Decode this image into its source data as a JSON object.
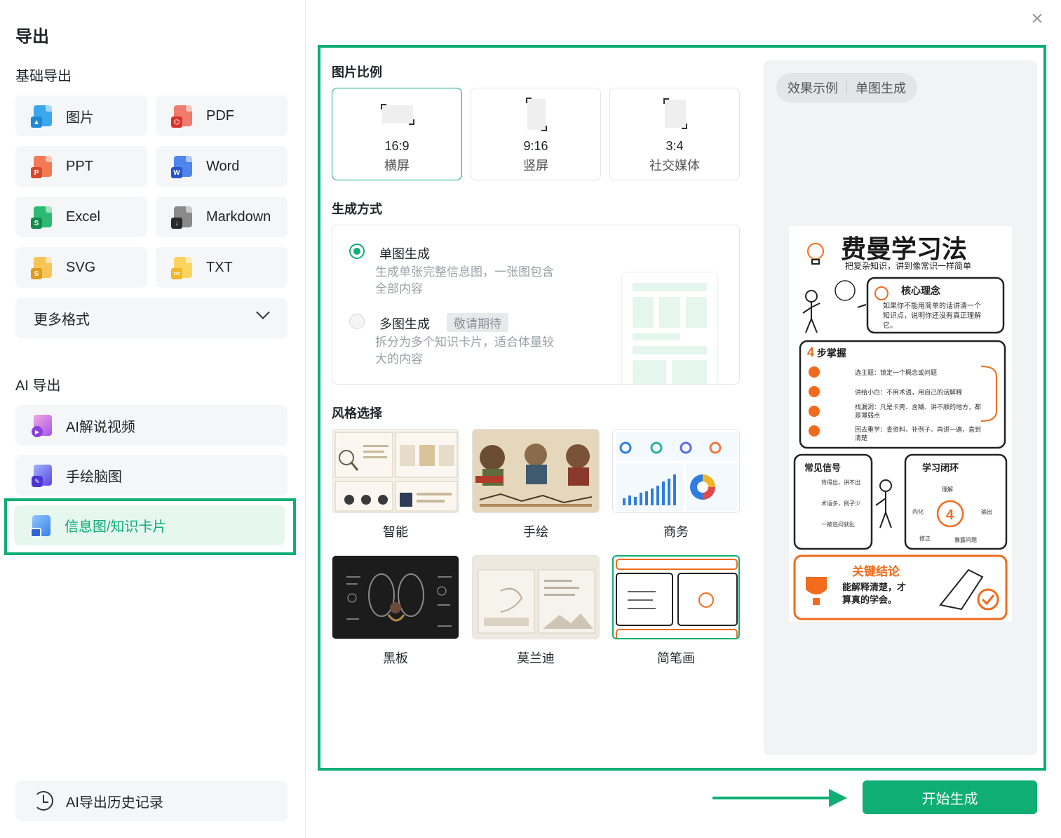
{
  "sidebar": {
    "title": "导出",
    "basic_label": "基础导出",
    "formats": [
      {
        "label": "图片",
        "icon": "image-file-icon",
        "color": "#3ba7ef"
      },
      {
        "label": "PDF",
        "icon": "pdf-file-icon",
        "color": "#e8453c"
      },
      {
        "label": "PPT",
        "icon": "ppt-file-icon",
        "color": "#e8553c"
      },
      {
        "label": "Word",
        "icon": "word-file-icon",
        "color": "#2f6de0"
      },
      {
        "label": "Excel",
        "icon": "excel-file-icon",
        "color": "#1aa15f"
      },
      {
        "label": "Markdown",
        "icon": "markdown-file-icon",
        "color": "#3a3a3a"
      },
      {
        "label": "SVG",
        "icon": "svg-file-icon",
        "color": "#f2b632"
      },
      {
        "label": "TXT",
        "icon": "txt-file-icon",
        "color": "#f4c343"
      }
    ],
    "more_formats": "更多格式",
    "ai_label": "AI 导出",
    "ai_items": [
      {
        "label": "AI解说视频",
        "icon": "ai-video-icon"
      },
      {
        "label": "手绘脑图",
        "icon": "mindmap-icon"
      },
      {
        "label": "信息图/知识卡片",
        "icon": "infographic-icon"
      }
    ],
    "history": "AI导出历史记录"
  },
  "main": {
    "ratio_label": "图片比例",
    "ratios": [
      {
        "value": "16:9",
        "name": "横屏"
      },
      {
        "value": "9:16",
        "name": "竖屏"
      },
      {
        "value": "3:4",
        "name": "社交媒体"
      }
    ],
    "mode_label": "生成方式",
    "single": {
      "title": "单图生成",
      "desc": "生成单张完整信息图，一张图包含全部内容"
    },
    "multi": {
      "title": "多图生成",
      "tag": "敬请期待",
      "desc": "拆分为多个知识卡片，适合体量较大的内容"
    },
    "style_label": "风格选择",
    "styles": [
      "智能",
      "手绘",
      "商务",
      "黑板",
      "莫兰迪",
      "简笔画"
    ],
    "preview": {
      "tab1": "效果示例",
      "tab2": "单图生成",
      "poster_title": "费曼学习法",
      "poster_subtitle": "把复杂知识，讲到像常识一样简单",
      "core_title": "核心理念",
      "core_text": "如果你不能用简单的话讲清一个知识点，说明你还没有真正理解它。",
      "steps_title": "步掌握",
      "steps": [
        "选主题：锁定一个概念或问题",
        "讲给小白：不用术语，用自己的话解释",
        "找漏洞：凡是卡壳、含糊、讲不顺的地方，都是薄弱点",
        "回去重学：查资料、补例子、再讲一遍，直到清楚"
      ],
      "signals_title": "常见信号",
      "signals": [
        "背得出，讲不出",
        "术语多，例子少",
        "一被追问就乱"
      ],
      "loop_title": "学习闭环",
      "loop": [
        "理解",
        "内化",
        "输出",
        "修正",
        "暴露问题"
      ],
      "conclusion_title": "关键结论",
      "conclusion_text": "能解释清楚，才算真的学会。"
    },
    "start_button": "开始生成"
  },
  "colors": {
    "accent": "#0fae74",
    "orange": "#f26b1d"
  }
}
